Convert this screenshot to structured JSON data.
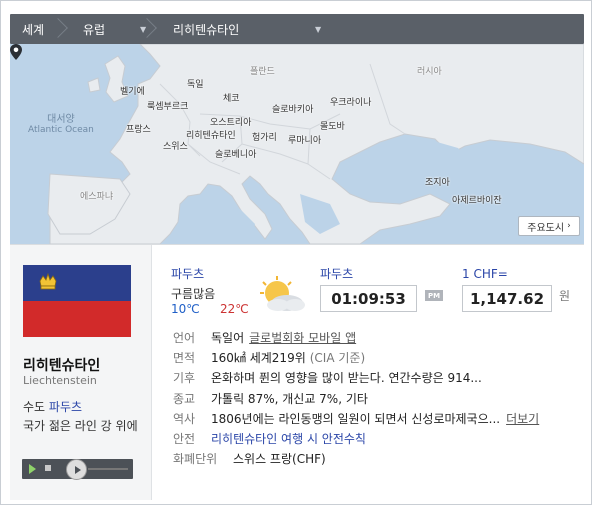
{
  "breadcrumb": {
    "world": "세계",
    "region": "유럽",
    "country": "리히텐슈타인",
    "caret": "▼"
  },
  "map": {
    "seas": [
      {
        "key": "atlantic",
        "ko": "대서양",
        "en": "Atlantic Ocean"
      }
    ],
    "countries": {
      "belgium": "벨기에",
      "germany": "독일",
      "poland": "폴란드",
      "russia": "러시아",
      "luxembourg": "룩셈부르크",
      "czech": "체코",
      "slovakia": "슬로바키아",
      "ukraine": "우크라이나",
      "france": "프랑스",
      "austria": "오스트리아",
      "liechtenstein": "리히텐슈타인",
      "switzerland": "스위스",
      "hungary": "헝가리",
      "moldova": "몰도바",
      "romania": "루마니아",
      "slovenia": "슬로베니아",
      "spain": "에스파냐",
      "georgia": "조지아",
      "azerbaijan": "아제르바이잔"
    },
    "major_cities_button": "주요도시"
  },
  "country": {
    "name_ko": "리히텐슈타인",
    "name_en": "Liechtenstein",
    "capital_label": "수도",
    "capital": "파두츠",
    "anthem_text": "국가 젊은 라인 강 위에"
  },
  "weather": {
    "city": "파두츠",
    "desc": "구름많음",
    "low": "10℃",
    "high": "22℃",
    "icon": "partly-cloudy-icon"
  },
  "clock": {
    "city": "파두츠",
    "time": "01:09:53",
    "ampm": "PM"
  },
  "exchange": {
    "label": "1 CHF=",
    "value": "1,147.62",
    "unit": "원"
  },
  "info": {
    "language": {
      "key": "언어",
      "value": "독일어",
      "link": "글로벌회화 모바일 앱"
    },
    "area": {
      "key": "면적",
      "value": "160㎢ 세계219위",
      "note": "(CIA 기준)"
    },
    "climate": {
      "key": "기후",
      "value": "온화하며 퓐의 영향을 많이 받는다. 연간수량은 914..."
    },
    "religion": {
      "key": "종교",
      "value": "가톨릭 87%, 개신교 7%, 기타"
    },
    "history": {
      "key": "역사",
      "value": "1806년에는 라인동맹의 일원이 되면서 신성로마제국으...",
      "more": "더보기"
    },
    "safety": {
      "key": "안전",
      "value": "리히텐슈타인 여행 시 안전수칙"
    },
    "currency": {
      "key": "화폐단위",
      "value": "스위스 프랑(CHF)"
    }
  },
  "colors": {
    "accent_blue": "#2b46a8",
    "breadcrumb_bg": "#5a6068",
    "sea": "#bcd3e8",
    "land": "#e9ecef",
    "flag_blue": "#2b3f8c",
    "flag_red": "#d22a2a"
  }
}
